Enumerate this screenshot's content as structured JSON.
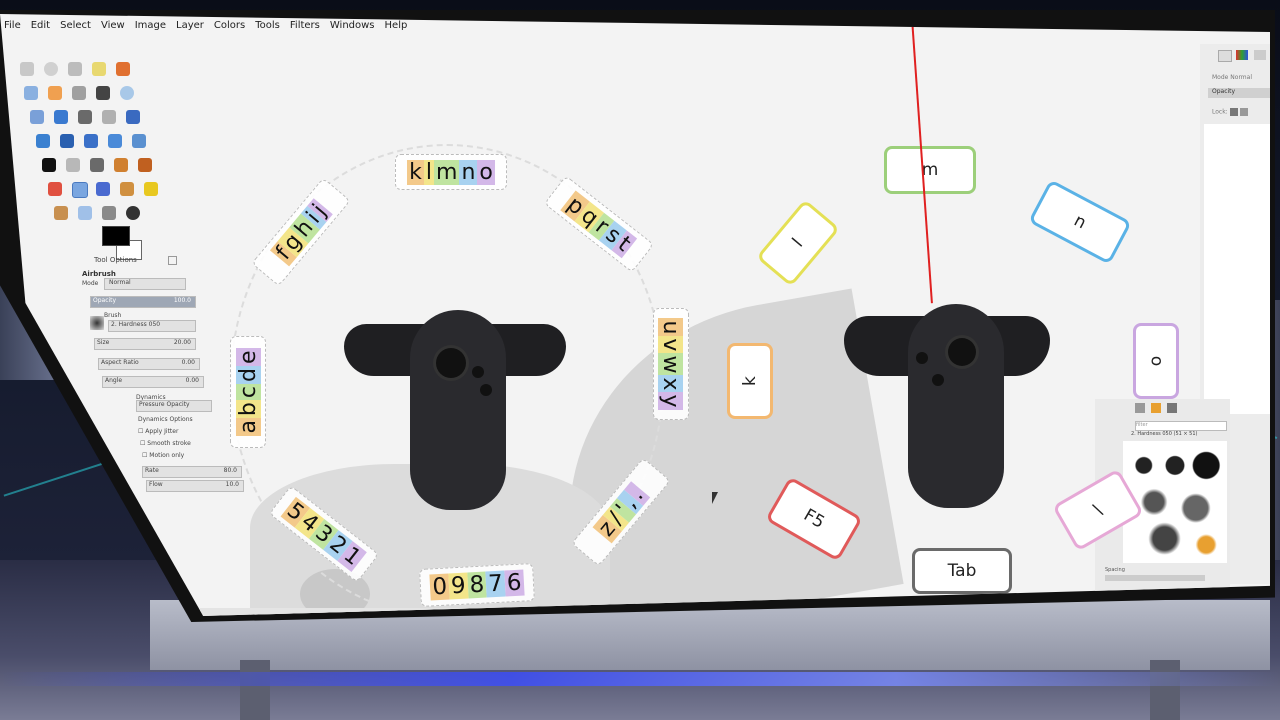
{
  "menu": [
    "File",
    "Edit",
    "Select",
    "View",
    "Image",
    "Layer",
    "Colors",
    "Tools",
    "Filters",
    "Windows",
    "Help"
  ],
  "tool_options": {
    "title": "Tool Options",
    "tool": "Airbrush",
    "mode_label": "Mode",
    "mode_value": "Normal",
    "opacity_label": "Opacity",
    "opacity_value": "100.0",
    "brush_label": "Brush",
    "brush_value": "2. Hardness 050",
    "size_label": "Size",
    "size_value": "20.00",
    "aspect_label": "Aspect Ratio",
    "aspect_value": "0.00",
    "angle_label": "Angle",
    "angle_value": "0.00",
    "dynamics_label": "Dynamics",
    "dynamics_value": "Pressure Opacity",
    "dynamics_options": "Dynamics Options",
    "apply_jitter": "Apply Jitter",
    "smooth_stroke": "Smooth stroke",
    "motion_only": "Motion only",
    "rate_label": "Rate",
    "rate_value": "80.0",
    "flow_label": "Flow",
    "flow_value": "10.0"
  },
  "dock": {
    "mode_label": "Mode",
    "mode_value": "Normal",
    "opacity_label": "Opacity",
    "lock_label": "Lock:"
  },
  "brush_panel": {
    "filter_label": "filter",
    "brush_name": "2. Hardness 050 (51 × 51)",
    "spacing_label": "Spacing"
  },
  "left_keyboard": [
    {
      "id": "abcde",
      "letters": [
        "a",
        "b",
        "c",
        "d",
        "e"
      ],
      "colors": [
        "#f3c98a",
        "#f3e58a",
        "#bfe4a0",
        "#a8d2f0",
        "#d3b8e8"
      ]
    },
    {
      "id": "fghij",
      "letters": [
        "f",
        "g",
        "h",
        "i",
        "j"
      ],
      "colors": [
        "#f3c98a",
        "#f3e58a",
        "#bfe4a0",
        "#a8d2f0",
        "#d3b8e8"
      ]
    },
    {
      "id": "klmno",
      "letters": [
        "k",
        "l",
        "m",
        "n",
        "o"
      ],
      "colors": [
        "#f3c98a",
        "#f3e58a",
        "#bfe4a0",
        "#a8d2f0",
        "#d3b8e8"
      ]
    },
    {
      "id": "pqrst",
      "letters": [
        "p",
        "q",
        "r",
        "s",
        "t"
      ],
      "colors": [
        "#f3c98a",
        "#f3e58a",
        "#bfe4a0",
        "#a8d2f0",
        "#d3b8e8"
      ]
    },
    {
      "id": "uvwxy",
      "letters": [
        "u",
        "v",
        "w",
        "x",
        "y"
      ],
      "colors": [
        "#f3c98a",
        "#f3e58a",
        "#bfe4a0",
        "#a8d2f0",
        "#d3b8e8"
      ]
    },
    {
      "id": "z",
      "letters": [
        "z",
        "/",
        "'",
        ",",
        "."
      ],
      "colors": [
        "#f3c98a",
        "#f3e58a",
        "#bfe4a0",
        "#a8d2f0",
        "#d3b8e8"
      ]
    },
    {
      "id": "09876",
      "letters": [
        "0",
        "9",
        "8",
        "7",
        "6"
      ],
      "colors": [
        "#f3c98a",
        "#f3e58a",
        "#bfe4a0",
        "#a8d2f0",
        "#d3b8e8"
      ]
    },
    {
      "id": "54321",
      "letters": [
        "5",
        "4",
        "3",
        "2",
        "1"
      ],
      "colors": [
        "#f3c98a",
        "#f3e58a",
        "#bfe4a0",
        "#a8d2f0",
        "#d3b8e8"
      ]
    }
  ],
  "right_keys": [
    {
      "id": "m",
      "label": "m",
      "color": "#9ccf7a"
    },
    {
      "id": "n",
      "label": "n",
      "color": "#5ab2e6"
    },
    {
      "id": "l",
      "label": "l",
      "color": "#e4e055"
    },
    {
      "id": "k",
      "label": "k",
      "color": "#f3b870"
    },
    {
      "id": "o",
      "label": "o",
      "color": "#c9a6e0"
    },
    {
      "id": "f5",
      "label": "F5",
      "color": "#e05a5a"
    },
    {
      "id": "tab",
      "label": "Tab",
      "color": "#6a6a6a"
    },
    {
      "id": "slash",
      "label": "\\",
      "color": "#e6a8d6"
    }
  ],
  "colors": {
    "laser": "#e02020",
    "screen_bg": "#f3f3f3",
    "fg_color": "#000000",
    "bg_color": "#ffffff"
  }
}
